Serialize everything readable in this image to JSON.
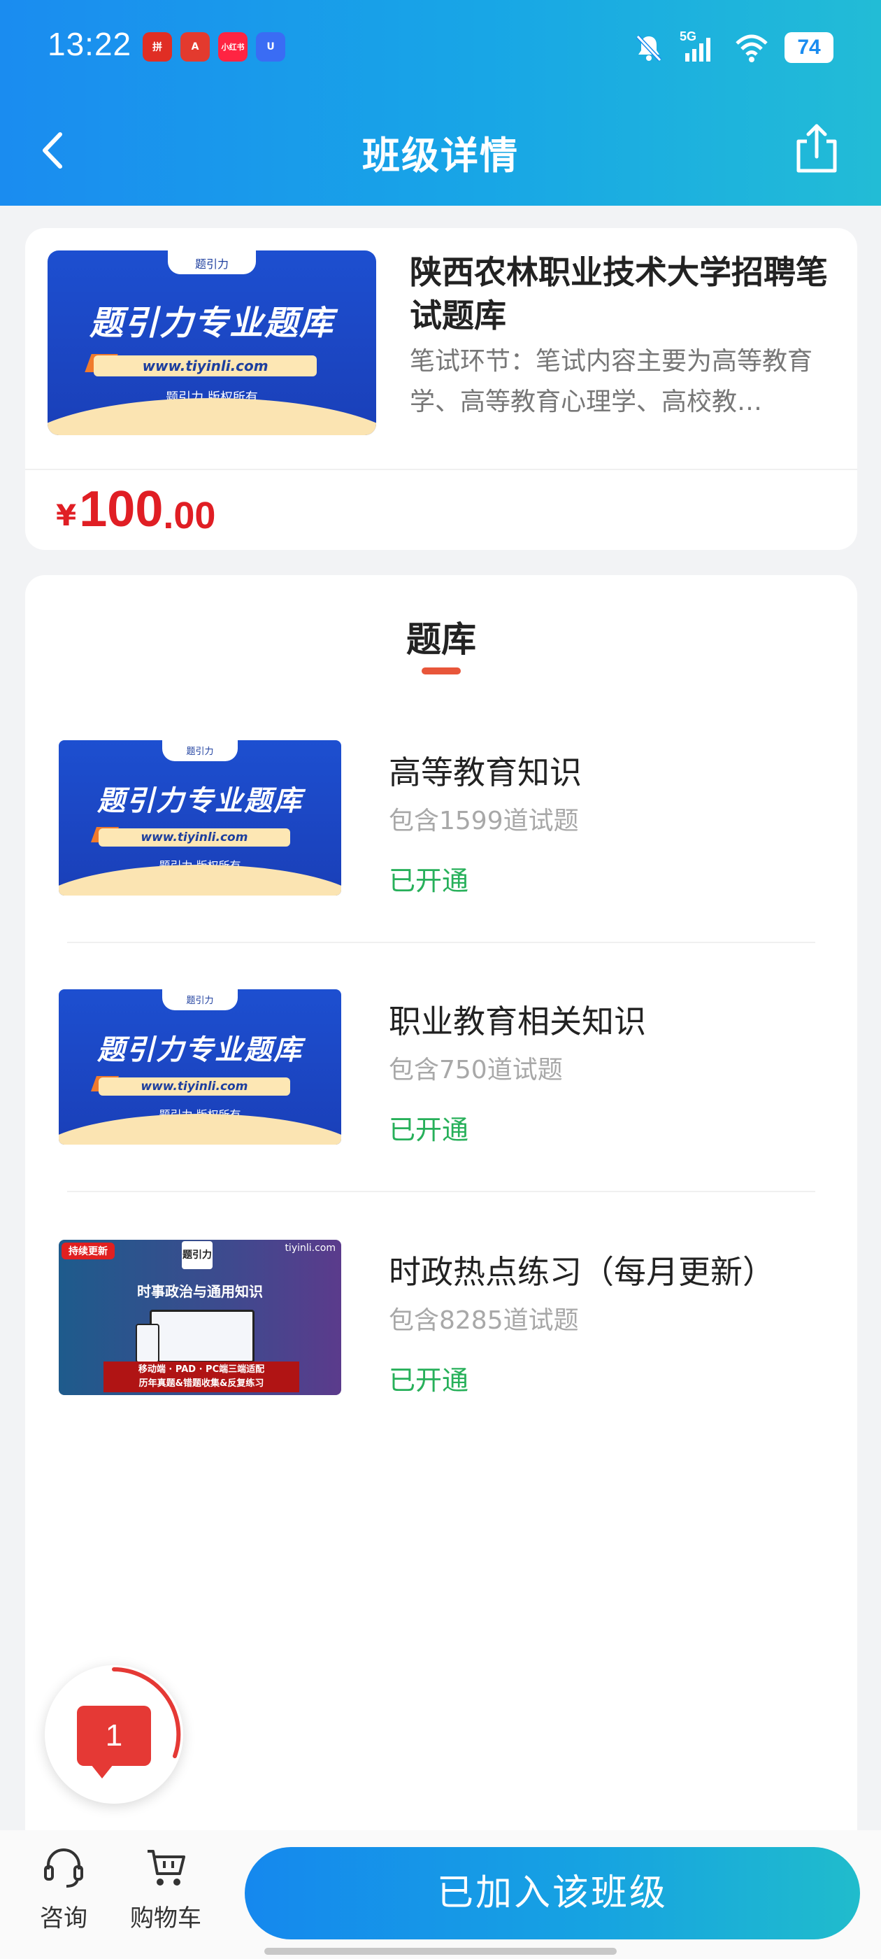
{
  "status_bar": {
    "time": "13:22",
    "battery": "74",
    "network": "5G",
    "app_icons": [
      {
        "name": "pinduoduo-app-icon",
        "color": "#e02e24",
        "glyph": "拼"
      },
      {
        "name": "app-a-icon",
        "color": "#e33a2e",
        "glyph": "A"
      },
      {
        "name": "xiaohongshu-app-icon",
        "color": "#ff2442",
        "glyph": "小红书"
      },
      {
        "name": "app-u-icon",
        "color": "#3a6cf4",
        "glyph": "U"
      }
    ]
  },
  "header": {
    "title": "班级详情"
  },
  "class_info": {
    "title": "陕西农林职业技术大学招聘笔试题库",
    "description": "笔试环节：笔试内容主要为高等教育学、高等教育心理学、高校教…",
    "price_symbol": "¥",
    "price_integer": "100",
    "price_decimal": ".00",
    "cover": {
      "tab_text": "题引力",
      "headline": "题引力专业题库",
      "url": "www.tiyinli.com",
      "copyright": "题引力 版权所有"
    }
  },
  "bank": {
    "section_title": "题库",
    "items": [
      {
        "title": "高等教育知识",
        "count": "包含1599道试题",
        "status": "已开通"
      },
      {
        "title": "职业教育相关知识",
        "count": "包含750道试题",
        "status": "已开通"
      },
      {
        "title": "时政热点练习（每月更新）",
        "count": "包含8285道试题",
        "status": "已开通"
      }
    ],
    "politics_cover": {
      "badge": "持续更新",
      "site": "tiyinli.com",
      "logo": "题引力",
      "headline": "时事政治与通用知识",
      "banner_line1": "移动端 · PAD · PC端三端适配",
      "banner_line2": "历年真题&错题收集&反复练习"
    }
  },
  "float_message": {
    "count": "1"
  },
  "bottom_bar": {
    "consult_label": "咨询",
    "cart_label": "购物车",
    "join_label": "已加入该班级"
  },
  "colors": {
    "header_gradient_start": "#1a8cf0",
    "header_gradient_end": "#22bcd6",
    "price": "#e01e24",
    "status_green": "#27b05a",
    "underline_accent": "#e8563a"
  }
}
